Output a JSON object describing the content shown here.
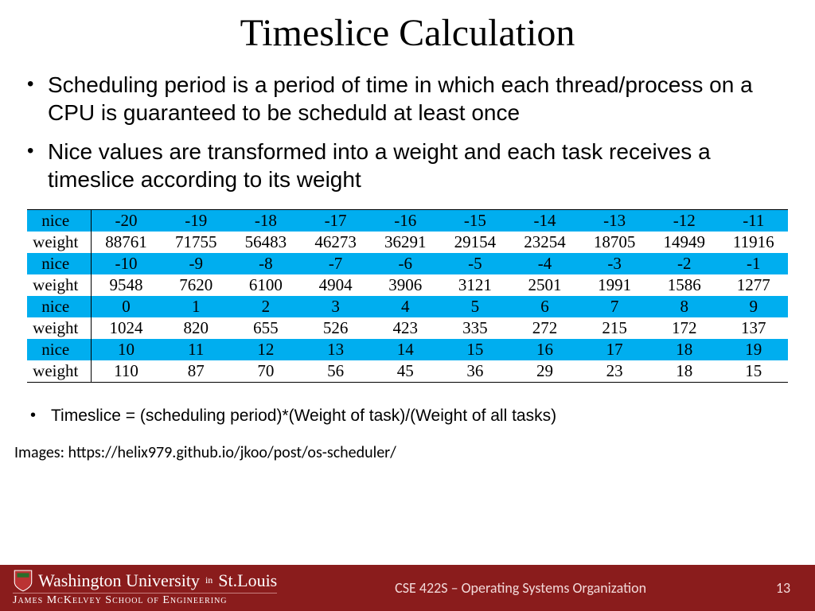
{
  "title": "Timeslice Calculation",
  "bullets": [
    "Scheduling period is a period of time in which each thread/process on a CPU is guaranteed to be scheduld at least once",
    "Nice values are transformed into a weight and each task receives a timeslice according to its weight"
  ],
  "table": {
    "row_label_nice": "nice",
    "row_label_weight": "weight",
    "groups": [
      {
        "nice": [
          "-20",
          "-19",
          "-18",
          "-17",
          "-16",
          "-15",
          "-14",
          "-13",
          "-12",
          "-11"
        ],
        "weight": [
          "88761",
          "71755",
          "56483",
          "46273",
          "36291",
          "29154",
          "23254",
          "18705",
          "14949",
          "11916"
        ]
      },
      {
        "nice": [
          "-10",
          "-9",
          "-8",
          "-7",
          "-6",
          "-5",
          "-4",
          "-3",
          "-2",
          "-1"
        ],
        "weight": [
          "9548",
          "7620",
          "6100",
          "4904",
          "3906",
          "3121",
          "2501",
          "1991",
          "1586",
          "1277"
        ]
      },
      {
        "nice": [
          "0",
          "1",
          "2",
          "3",
          "4",
          "5",
          "6",
          "7",
          "8",
          "9"
        ],
        "weight": [
          "1024",
          "820",
          "655",
          "526",
          "423",
          "335",
          "272",
          "215",
          "172",
          "137"
        ]
      },
      {
        "nice": [
          "10",
          "11",
          "12",
          "13",
          "14",
          "15",
          "16",
          "17",
          "18",
          "19"
        ],
        "weight": [
          "110",
          "87",
          "70",
          "56",
          "45",
          "36",
          "29",
          "23",
          "18",
          "15"
        ]
      }
    ]
  },
  "formula": "Timeslice = (scheduling period)*(Weight of task)/(Weight of all tasks)",
  "credit": "Images: https://helix979.github.io/jkoo/post/os-scheduler/",
  "footer": {
    "university_1": "Washington University",
    "university_in": "in",
    "university_2": "St.Louis",
    "school": "James McKelvey School of Engineering",
    "course": "CSE 422S – Operating Systems Organization",
    "page": "13"
  }
}
